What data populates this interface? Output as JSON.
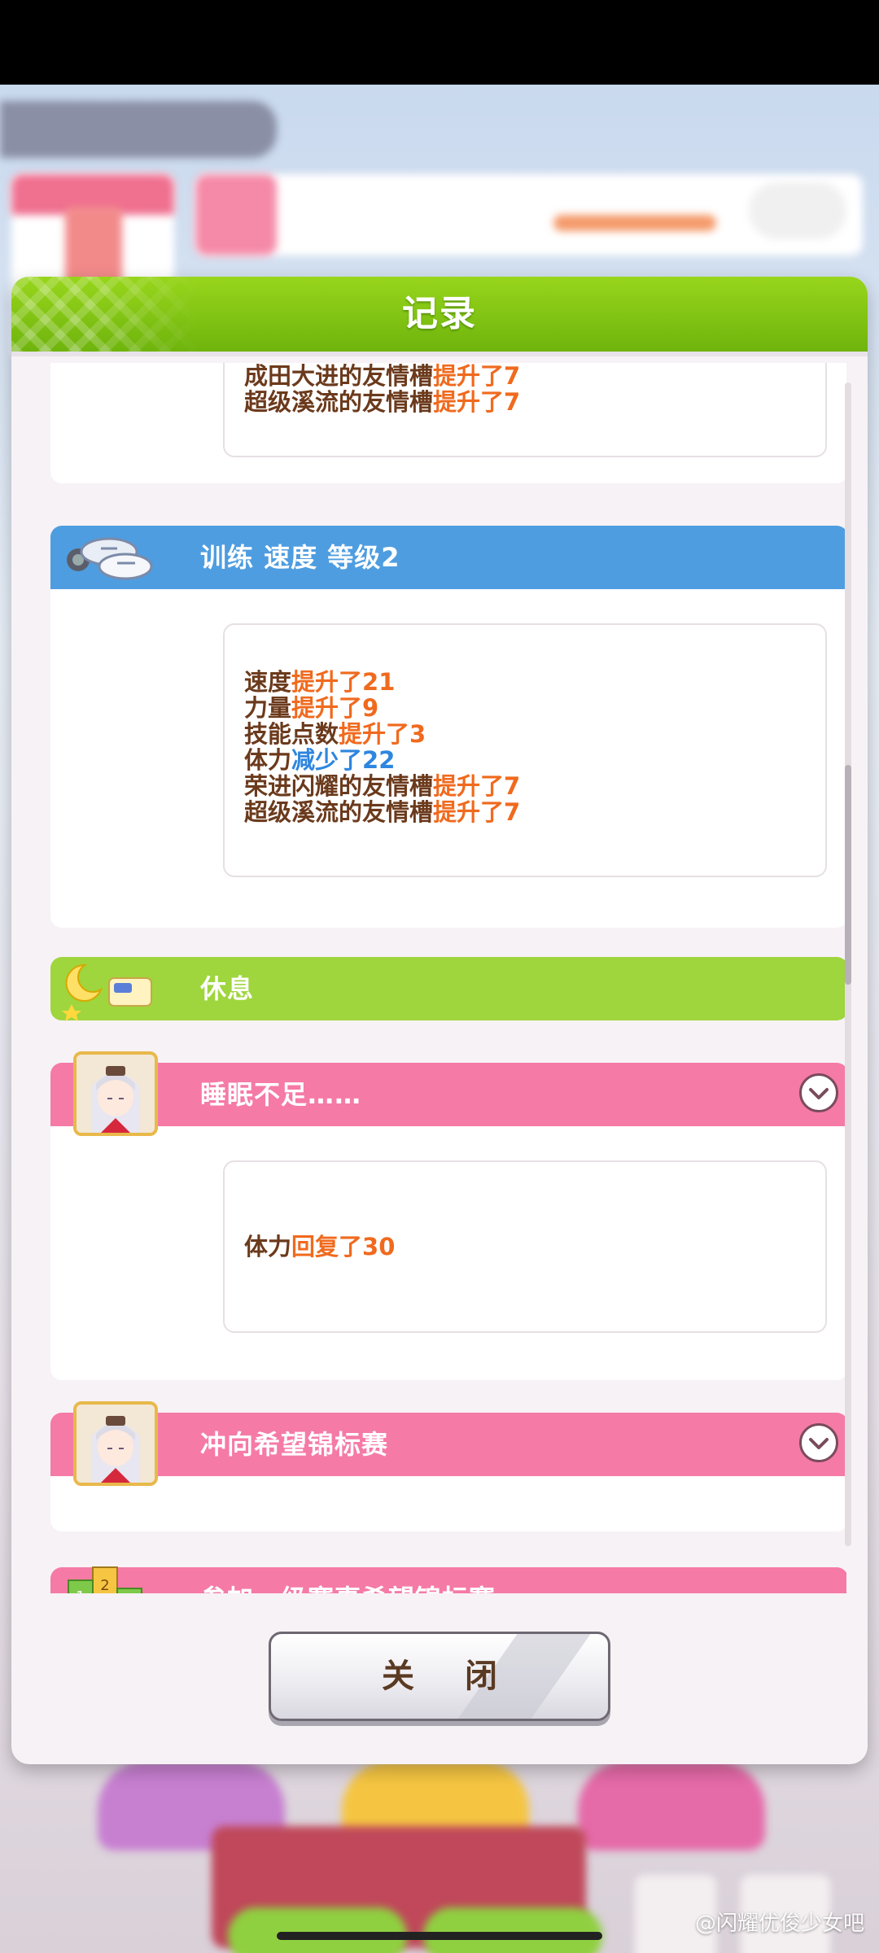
{
  "modal": {
    "title": "记录",
    "close_label": "关 闭"
  },
  "entries": [
    {
      "lines": [
        [
          {
            "t": "成田大进的友情槽",
            "c": "n"
          },
          {
            "t": "提升了7",
            "c": "o"
          }
        ],
        [
          {
            "t": "超级溪流的友情槽",
            "c": "n"
          },
          {
            "t": "提升了7",
            "c": "o"
          }
        ]
      ]
    },
    {
      "title": "训练  速度  等级2",
      "icon": "sneakers-icon",
      "lines": [
        [
          {
            "t": "速度",
            "c": "n"
          },
          {
            "t": "提升了21",
            "c": "o"
          }
        ],
        [
          {
            "t": "力量",
            "c": "n"
          },
          {
            "t": "提升了9",
            "c": "o"
          }
        ],
        [
          {
            "t": "技能点数",
            "c": "n"
          },
          {
            "t": "提升了3",
            "c": "o"
          }
        ],
        [
          {
            "t": "体力",
            "c": "n"
          },
          {
            "t": "减少了22",
            "c": "b"
          }
        ],
        [
          {
            "t": "荣进闪耀的友情槽",
            "c": "n"
          },
          {
            "t": "提升了7",
            "c": "o"
          }
        ],
        [
          {
            "t": "超级溪流的友情槽",
            "c": "n"
          },
          {
            "t": "提升了7",
            "c": "o"
          }
        ]
      ]
    },
    {
      "title": "休息",
      "icon": "moon-bed-icon"
    },
    {
      "title": "睡眠不足……",
      "icon": "character-portrait",
      "lines": [
        [
          {
            "t": "体力",
            "c": "n"
          },
          {
            "t": "回复了30",
            "c": "o"
          }
        ]
      ]
    },
    {
      "title": "冲向希望锦标赛",
      "icon": "character-portrait"
    },
    {
      "title": "参加一级赛事希望锦标赛",
      "icon": "race-ranking-icon"
    }
  ],
  "watermark": "@闪耀优俊少女吧",
  "colors": {
    "header_green": "#7cc014",
    "band_blue": "#4e9de0",
    "band_green": "#9fd53d",
    "band_pink": "#f57aa6",
    "increase": "#f06a1e",
    "decrease": "#2e86df",
    "body_text": "#6b3a1c"
  }
}
